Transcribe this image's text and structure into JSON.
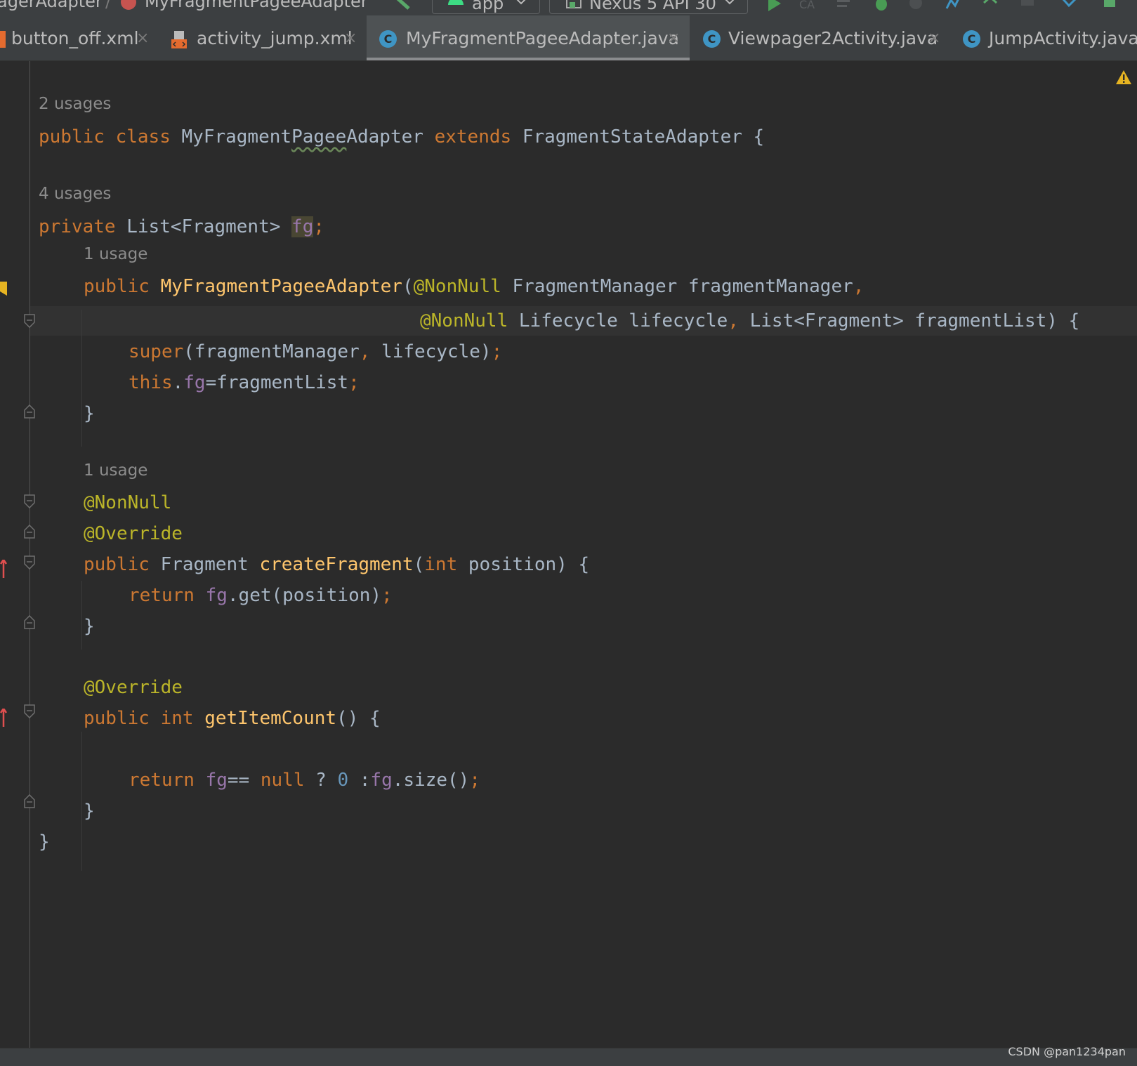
{
  "breadcrumb": {
    "item1": "agerAdapter",
    "separator": "/",
    "item2": "MyFragmentPageeAdapter"
  },
  "toolbar": {
    "run_config": "app",
    "device": "Nexus 5 API 30"
  },
  "tabs": [
    {
      "label": "button_off.xml",
      "icon": "xml-file-icon",
      "active": false
    },
    {
      "label": "activity_jump.xml",
      "icon": "layout-file-icon",
      "active": false
    },
    {
      "label": "MyFragmentPageeAdapter.java",
      "icon": "java-class-icon",
      "active": true
    },
    {
      "label": "Viewpager2Activity.java",
      "icon": "java-class-icon",
      "active": false
    },
    {
      "label": "JumpActivity.java",
      "icon": "java-class-icon",
      "active": false
    }
  ],
  "tab_close_glyph": "×",
  "class_icon_letter": "C",
  "code": {
    "hint_class": "2 usages",
    "hint_field": "4 usages",
    "hint_ctor": "1 usage",
    "hint_create": "1 usage",
    "l1": {
      "public": "public",
      "class": "class",
      "name_a": "MyFragment",
      "name_b": "Pagee",
      "name_c": "Adapter",
      "extends": "extends",
      "super": "FragmentStateAdapter",
      "brace": "{"
    },
    "l2": {
      "private": "private",
      "type": "List<Fragment>",
      "field": "fg",
      "semi": ";"
    },
    "l3": {
      "public": "public",
      "name": "MyFragmentPageeAdapter",
      "paren": "(",
      "ann": "@NonNull",
      "rest": "FragmentManager fragmentManager",
      "comma": ","
    },
    "l4": {
      "ann": "@NonNull",
      "p1": "Lifecycle lifecycle",
      "comma": ",",
      "p2": "List<Fragment> fragmentList) {"
    },
    "l5": {
      "super": "super",
      "args": "(fragmentManager",
      "comma": ",",
      "args2": "lifecycle)",
      "semi": ";"
    },
    "l6": {
      "this": "this",
      "dot": ".",
      "field": "fg",
      "rest": "=fragmentList",
      "semi": ";"
    },
    "l7": "}",
    "l8": "@NonNull",
    "l9": "@Override",
    "l10": {
      "public": "public",
      "type": "Fragment",
      "name": "createFragment",
      "paren": "(",
      "int": "int",
      "rest": "position) {"
    },
    "l11": {
      "return": "return",
      "field": "fg",
      "rest": ".get(position)",
      "semi": ";"
    },
    "l12": "}",
    "l13": "@Override",
    "l14": {
      "public": "public",
      "int": "int",
      "name": "getItemCount",
      "rest": "() {"
    },
    "l15": {
      "return": "return",
      "field": "fg",
      "eq": "==",
      "null": "null",
      "q": "?",
      "zero": "0",
      "colon": ":",
      "field2": "fg",
      "rest": ".size()",
      "semi": ";"
    },
    "l16": "}",
    "l17": "}"
  },
  "watermark": "CSDN @pan1234pan"
}
